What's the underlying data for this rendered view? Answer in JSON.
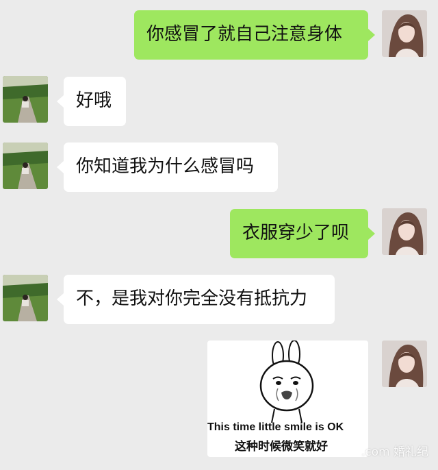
{
  "chat": {
    "messages": [
      {
        "side": "right",
        "text": "你感冒了就自己注意身体"
      },
      {
        "side": "left",
        "text": "好哦"
      },
      {
        "side": "left",
        "text": "你知道我为什么感冒吗"
      },
      {
        "side": "right",
        "text": "衣服穿少了呗"
      },
      {
        "side": "left",
        "text": "不，是我对你完全没有抵抗力"
      }
    ],
    "sticker": {
      "caption_en": "This time little smile is OK",
      "caption_cn": "这种时候微笑就好"
    }
  },
  "watermark": ".com 婚礼纪",
  "colors": {
    "background": "#ebebeb",
    "sent_bubble": "#9ee75f",
    "received_bubble": "#ffffff"
  }
}
